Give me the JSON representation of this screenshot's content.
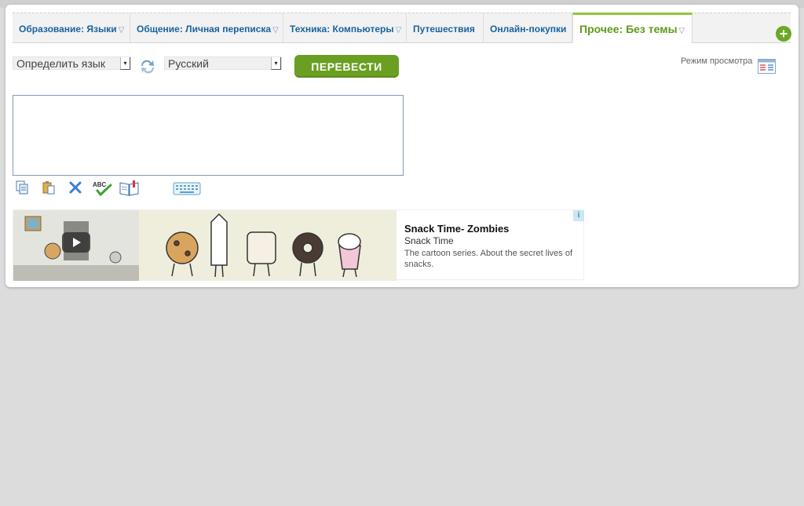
{
  "tabs": [
    {
      "label": "Образование: Языки",
      "arrow": "▽"
    },
    {
      "label": "Общение: Личная переписка",
      "arrow": "▽"
    },
    {
      "label": "Техника: Компьютеры",
      "arrow": "▽"
    },
    {
      "label": "Путешествия",
      "arrow": ""
    },
    {
      "label": "Онлайн-покупки",
      "arrow": ""
    },
    {
      "label": "Прочее: Без темы",
      "arrow": "▽"
    }
  ],
  "add_tab_symbol": "+",
  "source_language": "Определить язык",
  "target_language": "Русский",
  "select_caret": "▾",
  "translate_label": "ПЕРЕВЕСТИ",
  "view_mode_label": "Режим просмотра",
  "input_text": "",
  "toolbar_icons": [
    "copy-icon",
    "paste-icon",
    "clear-icon",
    "spellcheck-icon",
    "dictionary-icon",
    "keyboard-icon"
  ],
  "ad": {
    "title": "Snack Time- Zombies",
    "subtitle": "Snack Time",
    "description": "The cartoon series. About the secret lives of snacks.",
    "info_symbol": "i"
  },
  "colors": {
    "accent_green": "#6a9f22",
    "tab_link": "#1a63a0",
    "active_tab": "#5f9a1c"
  }
}
